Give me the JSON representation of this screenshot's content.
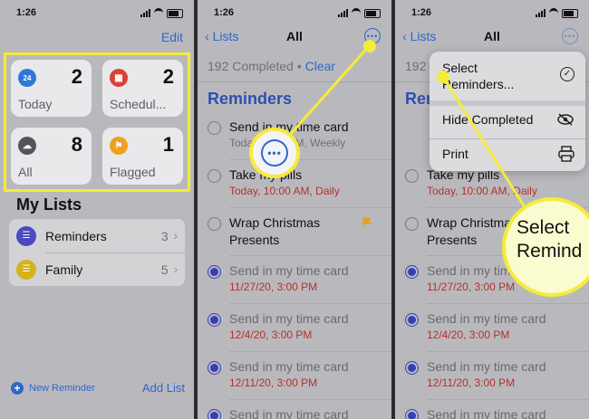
{
  "panel1": {
    "time": "1:26",
    "edit_label": "Edit",
    "smart_lists": [
      {
        "label": "Today",
        "count": "2",
        "icon": "calendar-icon",
        "color": "#2f78d8",
        "glyph": "24"
      },
      {
        "label": "Schedul...",
        "count": "2",
        "icon": "calendar-grid-icon",
        "color": "#d8423a",
        "glyph": "▦"
      },
      {
        "label": "All",
        "count": "8",
        "icon": "tray-icon",
        "color": "#555559",
        "glyph": "☁"
      },
      {
        "label": "Flagged",
        "count": "1",
        "icon": "flag-icon",
        "color": "#f0a020",
        "glyph": "⚑"
      }
    ],
    "my_lists_title": "My Lists",
    "lists": [
      {
        "name": "Reminders",
        "count": "3",
        "color": "#4a4bc0"
      },
      {
        "name": "Family",
        "count": "5",
        "color": "#d6b318"
      }
    ],
    "new_reminder_label": "New Reminder",
    "add_list_label": "Add List"
  },
  "panel2": {
    "time": "1:26",
    "back_label": "Lists",
    "title": "All",
    "completed_text": "192 Completed",
    "bullet": "•",
    "clear_label": "Clear",
    "section_title": "Reminders",
    "items": [
      {
        "title": "Send in my time card",
        "detail": "Today, 3:00 PM, Weekly",
        "done": false
      },
      {
        "title": "Take my pills",
        "detail": "Today, 10:00 AM, Daily",
        "done": false
      },
      {
        "title": "Wrap Christmas",
        "title2": "Presents",
        "done": false,
        "flagged": true
      },
      {
        "title": "Send in my time card",
        "detail": "11/27/20, 3:00 PM",
        "done": true
      },
      {
        "title": "Send in my time card",
        "detail": "12/4/20, 3:00 PM",
        "done": true
      },
      {
        "title": "Send in my time card",
        "detail": "12/11/20, 3:00 PM",
        "done": true
      },
      {
        "title": "Send in my time card",
        "detail": "",
        "done": true
      }
    ]
  },
  "panel3": {
    "time": "1:26",
    "back_label": "Lists",
    "title": "All",
    "completed_text": "192 C",
    "section_title": "Rem",
    "menu": [
      {
        "label": "Select",
        "label2": "Reminders...",
        "icon": "checkmark-circle-icon",
        "glyph": "✓"
      },
      {
        "label": "Hide Completed",
        "icon": "eye-slash-icon",
        "glyph": "◉"
      },
      {
        "label": "Print",
        "icon": "printer-icon",
        "glyph": "⎙"
      }
    ],
    "callout_line1": "Select",
    "callout_line2": "Remind"
  },
  "colors": {
    "highlight": "#f4ec3a",
    "accent": "#2f66c8",
    "date_red": "#b8302a"
  }
}
